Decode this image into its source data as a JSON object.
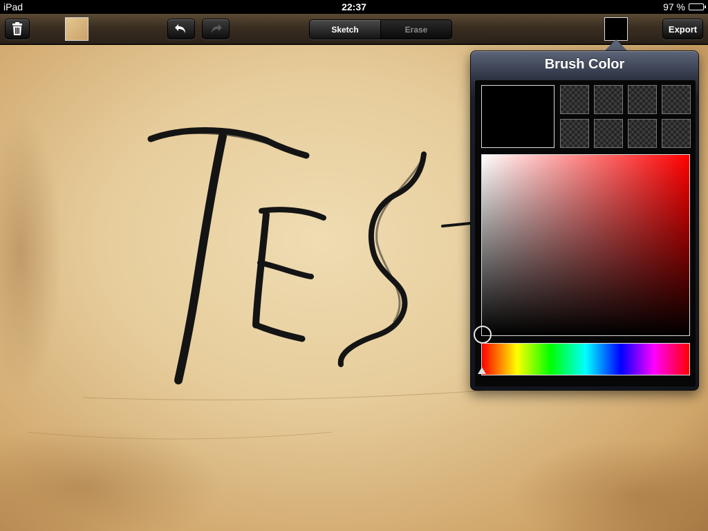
{
  "status_bar": {
    "device": "iPad",
    "time": "22:37",
    "battery": "97 %",
    "battery_level": 0.97
  },
  "toolbar": {
    "trash_icon": "trash-icon",
    "undo_icon": "undo-icon",
    "redo_icon": "redo-icon",
    "modes": [
      "Sketch",
      "Erase"
    ],
    "active_mode": "Sketch",
    "export_label": "Export",
    "brush_color": "#000000"
  },
  "canvas": {
    "drawn_text": "TES",
    "stroke_color": "#141414"
  },
  "popover": {
    "title": "Brush Color",
    "current_color": "#000000",
    "recent_count_visible": 8,
    "picker_hue": "#ff0000",
    "selected_hue_fraction": 0.0
  }
}
